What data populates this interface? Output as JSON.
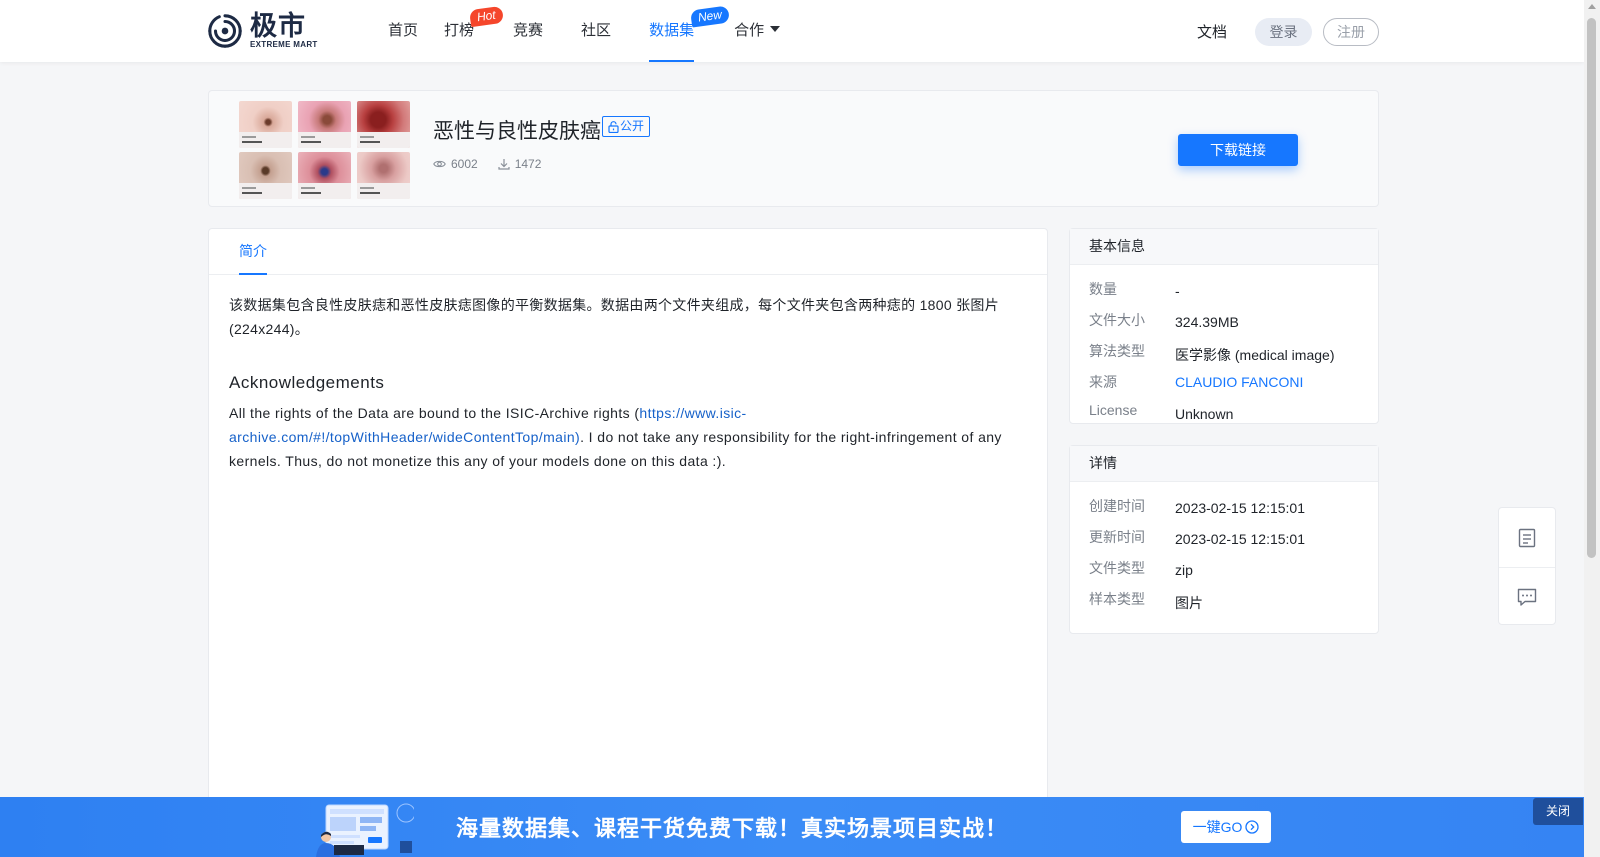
{
  "brand": {
    "name_cn": "极市",
    "name_en": "EXTREME MART"
  },
  "nav": {
    "items": [
      {
        "label": "首页"
      },
      {
        "label": "打榜",
        "badge": "Hot"
      },
      {
        "label": "竞赛"
      },
      {
        "label": "社区"
      },
      {
        "label": "数据集",
        "badge": "New",
        "active": true
      },
      {
        "label": "合作"
      }
    ],
    "docs": "文档",
    "login": "登录",
    "register": "注册"
  },
  "dataset": {
    "title": "恶性与良性皮肤癌",
    "visibility": "公开",
    "views": "6002",
    "downloads": "1472",
    "download_button": "下载链接"
  },
  "tabs": [
    {
      "label": "简介",
      "active": true
    }
  ],
  "description": {
    "intro": "该数据集包含良性皮肤痣和恶性皮肤痣图像的平衡数据集。数据由两个文件夹组成，每个文件夹包含两种痣的 1800 张图片(224x244)。",
    "ack_title": "Acknowledgements",
    "ack_before": "All the rights of the Data are bound to the ISIC-Archive rights (",
    "ack_link": "https://www.isic-archive.com/#!/topWithHeader/wideContentTop/main)",
    "ack_after": ". I do not take any responsibility for the right-infringement of any kernels. Thus, do not monetize this any of your models done on this data :)."
  },
  "basic_info": {
    "title": "基本信息",
    "rows": [
      {
        "key": "数量",
        "value": "-"
      },
      {
        "key": "文件大小",
        "value": "324.39MB"
      },
      {
        "key": "算法类型",
        "value": "医学影像 (medical image)"
      },
      {
        "key": "来源",
        "value": "CLAUDIO FANCONI"
      },
      {
        "key": "License",
        "value": "Unknown"
      }
    ]
  },
  "details": {
    "title": "详情",
    "rows": [
      {
        "key": "创建时间",
        "value": "2023-02-15 12:15:01"
      },
      {
        "key": "更新时间",
        "value": "2023-02-15 12:15:01"
      },
      {
        "key": "文件类型",
        "value": "zip"
      },
      {
        "key": "样本类型",
        "value": "图片"
      }
    ]
  },
  "banner": {
    "text": "海量数据集、课程干货免费下载！真实场景项目实战！",
    "button": "一键GO",
    "close": "关闭"
  },
  "colors": {
    "accent": "#1677ff",
    "hot": "#f5462b",
    "banner": "#3584f3"
  }
}
